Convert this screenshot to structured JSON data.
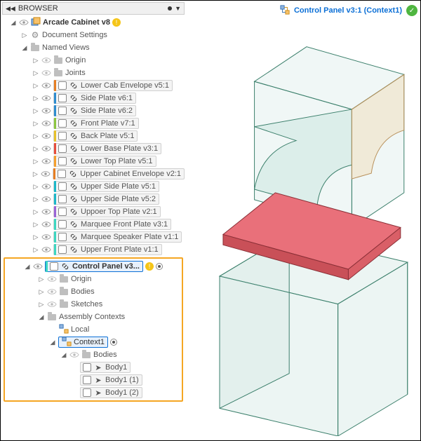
{
  "header": {
    "browser_label": "BROWSER",
    "active_component": "Control Panel v3:1 (Context1)"
  },
  "tree": {
    "root": {
      "label": "Arcade Cabinet v8"
    },
    "doc_settings": "Document Settings",
    "named_views": "Named Views",
    "origin": "Origin",
    "joints": "Joints",
    "components": [
      {
        "label": "Lower Cab Envelope v5:1",
        "color": "#e67e22"
      },
      {
        "label": "Side Plate v6:1",
        "color": "#2d8ccf"
      },
      {
        "label": "Side Plate v6:2",
        "color": "#2d8ccf"
      },
      {
        "label": "Front Plate v7:1",
        "color": "#8cc63f"
      },
      {
        "label": "Back Plate v5:1",
        "color": "#e7c12a"
      },
      {
        "label": "Lower Base Plate v3:1",
        "color": "#e74c3c"
      },
      {
        "label": "Lower Top Plate v5:1",
        "color": "#f59f2d"
      },
      {
        "label": "Upper Cabinet Envelope v2:1",
        "color": "#e67e22"
      },
      {
        "label": "Upper Side Plate v5:1",
        "color": "#1bb7c9"
      },
      {
        "label": "Upper Side Plate v5:2",
        "color": "#1bb7c9"
      },
      {
        "label": "Uppoer Top Plate v2:1",
        "color": "#9a65d6"
      },
      {
        "label": "Marquee Front Plate v3:1",
        "color": "#3dd6c1"
      },
      {
        "label": "Marquee Speaker Plate v1:1",
        "color": "#3dd6c1"
      },
      {
        "label": "Upper Front Plate v1:1",
        "color": "#3dd6c1"
      }
    ],
    "control_panel": {
      "label": "Control Panel v3...",
      "color": "#3dd6c1",
      "children": {
        "origin": "Origin",
        "bodies": "Bodies",
        "sketches": "Sketches",
        "assembly_contexts": "Assembly Contexts",
        "local": "Local",
        "context1": "Context1",
        "context_bodies": "Bodies",
        "body_items": [
          "Body1",
          "Body1 (1)",
          "Body1 (2)"
        ]
      }
    }
  }
}
